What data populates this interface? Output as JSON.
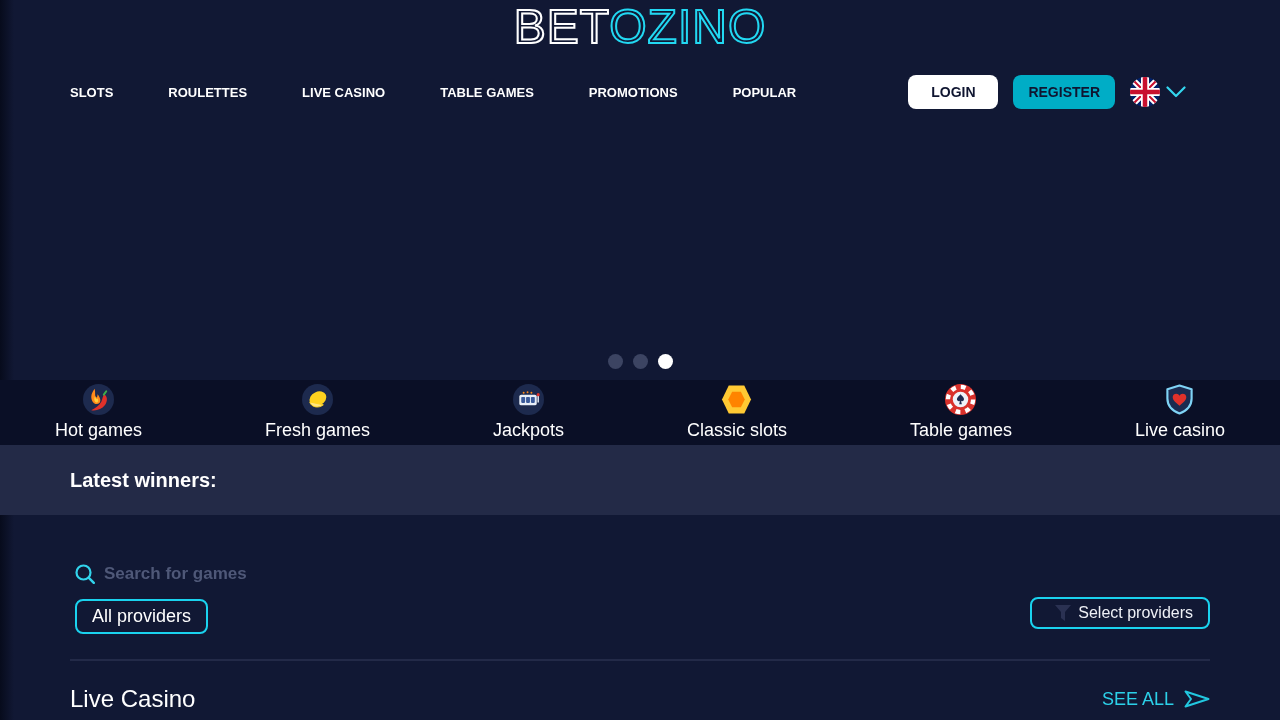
{
  "header": {
    "logo": {
      "brand": "BET",
      "accent": "OZINO"
    },
    "nav": [
      "SLOTS",
      "ROULETTES",
      "LIVE CASINO",
      "TABLE GAMES",
      "PROMOTIONS",
      "POPULAR"
    ],
    "login_button": "LOGIN",
    "register_button": "REGISTER"
  },
  "banner": {
    "dots": [
      {
        "selected": false
      },
      {
        "selected": false
      },
      {
        "selected": true
      }
    ]
  },
  "categories": [
    {
      "kind": "chili",
      "label": "Hot games"
    },
    {
      "kind": "lemon",
      "label": "Fresh games"
    },
    {
      "kind": "slot_machine",
      "label": "Jackpots"
    },
    {
      "kind": "hexagon",
      "label": "Classic slots"
    },
    {
      "kind": "poker_chip",
      "label": "Table games"
    },
    {
      "kind": "shield",
      "label": "Live casino"
    }
  ],
  "latest_winners": {
    "title": "Latest winners:"
  },
  "games": {
    "search": {
      "placeholder": "Search for games"
    },
    "all_providers_button": "All providers",
    "select_providers_button": "Select providers",
    "section": {
      "title": "Live Casino",
      "see_all": "SEE ALL"
    }
  }
}
